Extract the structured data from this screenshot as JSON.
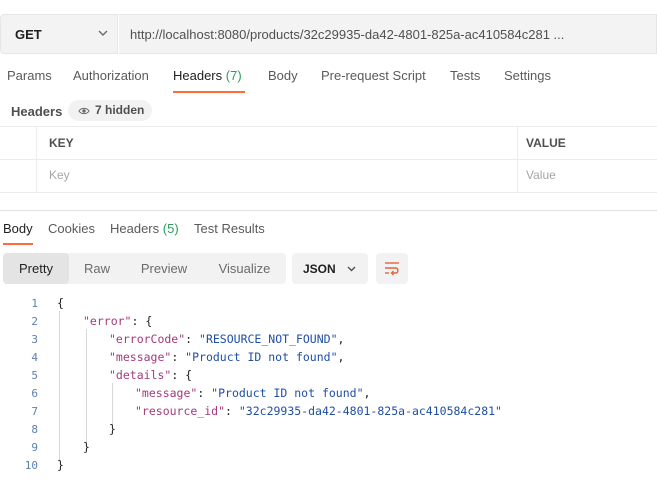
{
  "request": {
    "method": "GET",
    "url": "http://localhost:8080/products/32c29935-da42-4801-825a-ac410584c281 ..."
  },
  "request_tabs": [
    {
      "label": "Params",
      "count": ""
    },
    {
      "label": "Authorization",
      "count": ""
    },
    {
      "label": "Headers",
      "count": "(7)"
    },
    {
      "label": "Body",
      "count": ""
    },
    {
      "label": "Pre-request Script",
      "count": ""
    },
    {
      "label": "Tests",
      "count": ""
    },
    {
      "label": "Settings",
      "count": ""
    }
  ],
  "headers_section": {
    "title": "Headers",
    "hidden_label": "7 hidden",
    "col_key": "KEY",
    "col_value": "VALUE",
    "key_placeholder": "Key",
    "value_placeholder": "Value"
  },
  "response_tabs": [
    {
      "label": "Body",
      "count": ""
    },
    {
      "label": "Cookies",
      "count": ""
    },
    {
      "label": "Headers",
      "count": "(5)"
    },
    {
      "label": "Test Results",
      "count": ""
    }
  ],
  "view_modes": [
    "Pretty",
    "Raw",
    "Preview",
    "Visualize"
  ],
  "format": "JSON",
  "code": {
    "line_numbers": [
      "1",
      "2",
      "3",
      "4",
      "5",
      "6",
      "7",
      "8",
      "9",
      "10"
    ],
    "tokens": {
      "l1": "{",
      "l2_key": "\"error\"",
      "l2_rest": ": {",
      "l3_key": "\"errorCode\"",
      "l3_sep": ": ",
      "l3_val": "\"RESOURCE_NOT_FOUND\"",
      "l3_end": ",",
      "l4_key": "\"message\"",
      "l4_sep": ": ",
      "l4_val": "\"Product ID not found\"",
      "l4_end": ",",
      "l5_key": "\"details\"",
      "l5_rest": ": {",
      "l6_key": "\"message\"",
      "l6_sep": ": ",
      "l6_val": "\"Product ID not found\"",
      "l6_end": ",",
      "l7_key": "\"resource_id\"",
      "l7_sep": ": ",
      "l7_val": "\"32c29935-da42-4801-825a-ac410584c281\"",
      "l8": "}",
      "l9": "}",
      "l10": "}"
    }
  },
  "colors": {
    "accent": "#ff6c37",
    "count_green": "#2a9d5c",
    "json_key": "#a23a7e",
    "json_string": "#1f4fa3"
  }
}
